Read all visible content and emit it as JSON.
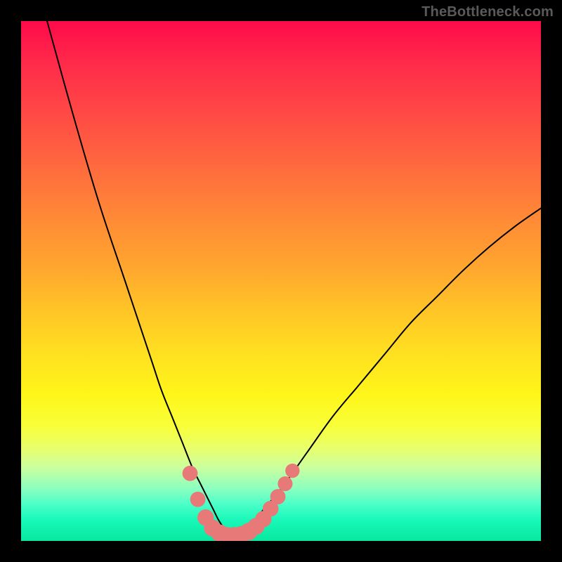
{
  "watermark": "TheBottleneck.com",
  "colors": {
    "frame": "#000000",
    "curve": "#000000",
    "dot_fill": "#e77a78",
    "dot_stroke": "#c94f4d",
    "gradient_top": "#ff0a4a",
    "gradient_bottom": "#08e8a0"
  },
  "chart_data": {
    "type": "line",
    "title": "",
    "xlabel": "",
    "ylabel": "",
    "xlim": [
      0,
      100
    ],
    "ylim": [
      0,
      100
    ],
    "series": [
      {
        "name": "left-branch",
        "x": [
          5,
          10,
          15,
          20,
          25,
          27,
          29,
          31,
          33,
          34.5,
          36,
          37,
          38,
          39,
          40,
          41
        ],
        "y": [
          100,
          82,
          65,
          50,
          35,
          29,
          24,
          19,
          14,
          11,
          8,
          6,
          4,
          2.5,
          1.5,
          1
        ]
      },
      {
        "name": "right-branch",
        "x": [
          41,
          43,
          45,
          47,
          50,
          55,
          60,
          65,
          70,
          75,
          80,
          85,
          90,
          95,
          100
        ],
        "y": [
          1,
          2,
          4,
          6.5,
          10,
          17,
          24,
          30,
          36,
          42,
          47,
          52,
          56.5,
          60.5,
          64
        ]
      }
    ],
    "markers": [
      {
        "x": 32.5,
        "y": 13,
        "r": 1.6
      },
      {
        "x": 34.0,
        "y": 8,
        "r": 1.6
      },
      {
        "x": 35.5,
        "y": 4.5,
        "r": 1.8
      },
      {
        "x": 36.8,
        "y": 2.5,
        "r": 1.9
      },
      {
        "x": 38.2,
        "y": 1.5,
        "r": 2.0
      },
      {
        "x": 39.6,
        "y": 1.0,
        "r": 2.0
      },
      {
        "x": 41.0,
        "y": 1.0,
        "r": 2.0
      },
      {
        "x": 42.4,
        "y": 1.2,
        "r": 2.0
      },
      {
        "x": 43.8,
        "y": 1.8,
        "r": 2.0
      },
      {
        "x": 45.2,
        "y": 2.8,
        "r": 1.9
      },
      {
        "x": 46.6,
        "y": 4.2,
        "r": 1.8
      },
      {
        "x": 48.0,
        "y": 6.2,
        "r": 1.7
      },
      {
        "x": 49.4,
        "y": 8.5,
        "r": 1.6
      },
      {
        "x": 50.8,
        "y": 11.0,
        "r": 1.5
      },
      {
        "x": 52.2,
        "y": 13.5,
        "r": 1.4
      }
    ]
  }
}
